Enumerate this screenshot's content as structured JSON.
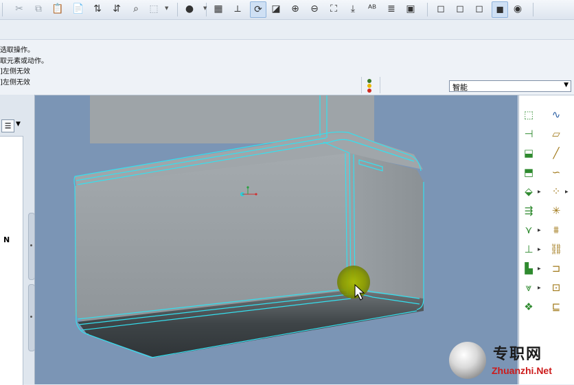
{
  "toolbar": {
    "buttons": [
      {
        "name": "cut-icon",
        "glyph": "✂"
      },
      {
        "name": "copy-icon",
        "glyph": "⧉"
      },
      {
        "name": "paste-icon",
        "glyph": "📋"
      },
      {
        "name": "paste-special-icon",
        "glyph": "📄"
      },
      {
        "name": "regenerate-icon",
        "glyph": "⇅"
      },
      {
        "name": "regenerate-manager-icon",
        "glyph": "⇵"
      },
      {
        "name": "find-icon",
        "glyph": "⌕"
      },
      {
        "name": "select-box-icon",
        "glyph": "⬚"
      },
      {
        "name": "appearance-sphere-icon",
        "glyph": "●"
      },
      {
        "name": "view-display-icon",
        "glyph": "▦"
      },
      {
        "name": "datum-display-icon",
        "glyph": "⟂"
      },
      {
        "name": "spin-center-icon",
        "glyph": "⟳"
      },
      {
        "name": "orient-icon",
        "glyph": "◪"
      },
      {
        "name": "zoom-in-icon",
        "glyph": "⊕"
      },
      {
        "name": "zoom-out-icon",
        "glyph": "⊖"
      },
      {
        "name": "refit-icon",
        "glyph": "⛶"
      },
      {
        "name": "reorient-icon",
        "glyph": "⤓"
      },
      {
        "name": "annotation-icon",
        "glyph": "ᴬᴮ"
      },
      {
        "name": "layers-icon",
        "glyph": "≣"
      },
      {
        "name": "saved-views-icon",
        "glyph": "▣"
      },
      {
        "name": "wireframe-icon",
        "glyph": "◻"
      },
      {
        "name": "hidden-line-icon",
        "glyph": "◻"
      },
      {
        "name": "no-hidden-icon",
        "glyph": "◻"
      },
      {
        "name": "shading-icon",
        "glyph": "◼"
      },
      {
        "name": "enhanced-realism-icon",
        "glyph": "◉"
      }
    ]
  },
  "messages": [
    "选取操作。",
    "取元素或动作。",
    "]左侧无效",
    "]左侧无效"
  ],
  "status": {
    "filter_value": "智能",
    "traffic_light_colors": [
      "#3a7a2a",
      "#e8b800",
      "#d12b20"
    ]
  },
  "left_panel": {
    "label": "N"
  },
  "right_panel": {
    "left_column": [
      {
        "name": "datum-plane-tool-icon",
        "glyph": "⬚",
        "color": "g",
        "flyout": false
      },
      {
        "name": "datum-axis-tool-icon",
        "glyph": "⊣",
        "color": "g",
        "flyout": false
      },
      {
        "name": "extrude-tool-icon",
        "glyph": "⬓",
        "color": "g",
        "flyout": false
      },
      {
        "name": "revolve-tool-icon",
        "glyph": "⬒",
        "color": "g",
        "flyout": false
      },
      {
        "name": "sweep-tool-icon",
        "glyph": "⬙",
        "color": "g",
        "flyout": true
      },
      {
        "name": "blend-tool-icon",
        "glyph": "⇶",
        "color": "g",
        "flyout": false
      },
      {
        "name": "hole-tool-icon",
        "glyph": "⋎",
        "color": "g",
        "flyout": true
      },
      {
        "name": "shell-tool-icon",
        "glyph": "⊥",
        "color": "g",
        "flyout": true
      },
      {
        "name": "rib-tool-icon",
        "glyph": "▙",
        "color": "g",
        "flyout": true
      },
      {
        "name": "draft-tool-icon",
        "glyph": "⩔",
        "color": "g",
        "flyout": true
      },
      {
        "name": "round-tool-icon",
        "glyph": "❖",
        "color": "g",
        "flyout": false
      }
    ],
    "right_column": [
      {
        "name": "sketch-curve-icon",
        "glyph": "∿",
        "color": "b",
        "flyout": false
      },
      {
        "name": "datum-plane-icon",
        "glyph": "▱",
        "color": "o",
        "flyout": false
      },
      {
        "name": "datum-axis-icon",
        "glyph": "╱",
        "color": "o",
        "flyout": false
      },
      {
        "name": "datum-curve-icon",
        "glyph": "∽",
        "color": "o",
        "flyout": false
      },
      {
        "name": "datum-point-icon",
        "glyph": "⁘",
        "color": "o",
        "flyout": true
      },
      {
        "name": "coordinate-system-icon",
        "glyph": "✳",
        "color": "o",
        "flyout": false
      },
      {
        "name": "analysis-feature-icon",
        "glyph": "⩩",
        "color": "o",
        "flyout": false
      },
      {
        "name": "chain-icon",
        "glyph": "⛓",
        "color": "o",
        "flyout": false
      },
      {
        "name": "annotation-feature-icon",
        "glyph": "⊐",
        "color": "o",
        "flyout": false
      },
      {
        "name": "insert-image-icon",
        "glyph": "⊡",
        "color": "o",
        "flyout": false
      },
      {
        "name": "copy-feature-icon",
        "glyph": "⊑",
        "color": "o",
        "flyout": false
      }
    ]
  },
  "watermark": {
    "text": "专职网",
    "url": "Zhuanzhi.Net"
  }
}
